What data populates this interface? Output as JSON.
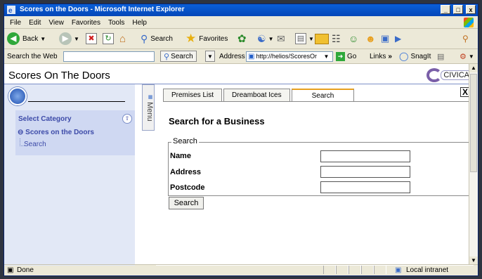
{
  "window": {
    "title": "Scores on the Doors - Microsoft Internet Explorer",
    "controls": [
      "_",
      "□",
      "x"
    ]
  },
  "menubar": [
    "File",
    "Edit",
    "View",
    "Favorites",
    "Tools",
    "Help"
  ],
  "toolbar": {
    "back_label": "Back",
    "search_label": "Search",
    "favorites_label": "Favorites"
  },
  "addressbar": {
    "search_web_label": "Search the Web",
    "search_btn_label": "Search",
    "address_label": "Address",
    "url": "http://helios/ScoresOr",
    "go_label": "Go",
    "links_label": "Links",
    "snagit_label": "SnagIt"
  },
  "app": {
    "title": "Scores On The Doors",
    "logo_text": "CIVICA",
    "sidebar": {
      "category_heading": "Select Category",
      "category_item": "Scores on the Doors",
      "sub_item": "Search"
    },
    "menu_tab_label": "Menu",
    "tabs": [
      "Premises List",
      "Dreamboat Ices",
      "Search"
    ],
    "close_label": "X",
    "section_title": "Search for a Business",
    "fieldset_legend": "Search",
    "fields": {
      "name": {
        "label": "Name",
        "value": ""
      },
      "address": {
        "label": "Address",
        "value": ""
      },
      "postcode": {
        "label": "Postcode",
        "value": ""
      }
    },
    "search_button": "Search"
  },
  "statusbar": {
    "status": "Done",
    "zone": "Local intranet"
  }
}
